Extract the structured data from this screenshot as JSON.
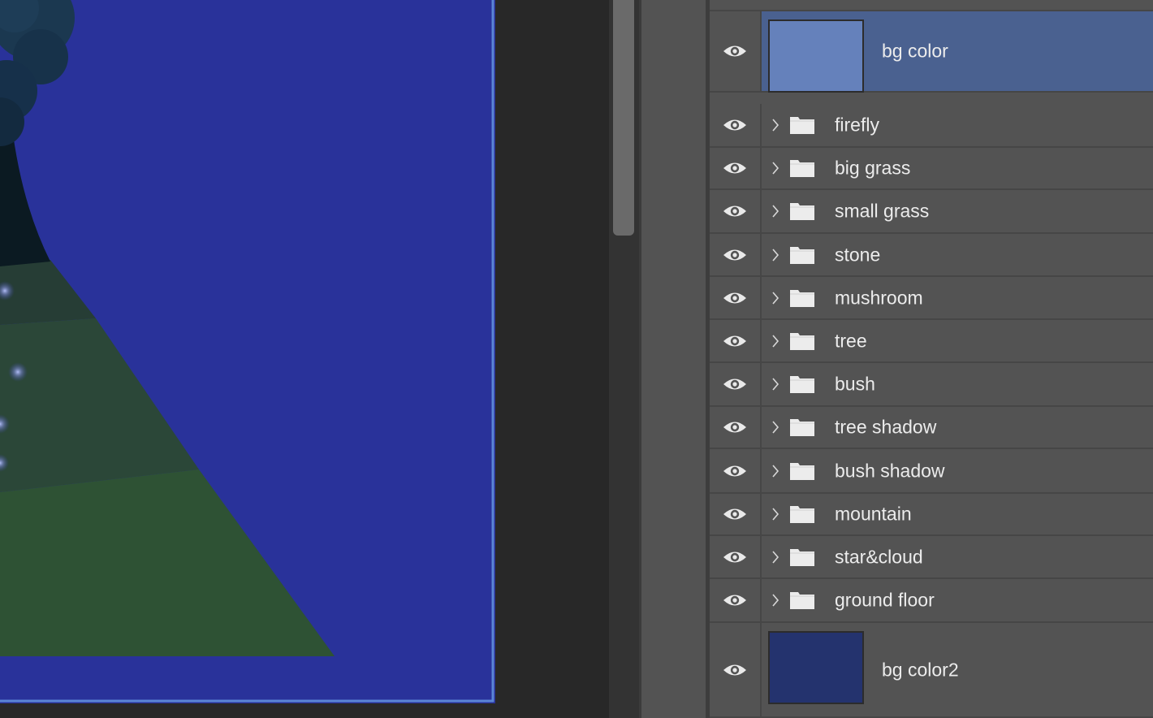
{
  "colors": {
    "canvas_bg": "#282828",
    "artboard_blue": "#29329a",
    "selection_border": "#5b86d6",
    "panel_bg": "#535353",
    "row_selected": "#4a6190",
    "thumb_bg_color": "#6581bb",
    "thumb_bg_color2": "#24336e",
    "grass_dark": "#263d35",
    "grass_mid": "#2b4738",
    "grass_light": "#2e5234",
    "tree_trunk": "#0b1a22",
    "tree_foliage": "#173045"
  },
  "layers": [
    {
      "name": "bg color",
      "type": "layer",
      "selected": true,
      "visible": true,
      "thumb": "thumb_bg_color"
    },
    {
      "name": "firefly",
      "type": "group",
      "visible": true
    },
    {
      "name": "big grass",
      "type": "group",
      "visible": true
    },
    {
      "name": "small grass",
      "type": "group",
      "visible": true
    },
    {
      "name": "stone",
      "type": "group",
      "visible": true
    },
    {
      "name": "mushroom",
      "type": "group",
      "visible": true
    },
    {
      "name": "tree",
      "type": "group",
      "visible": true
    },
    {
      "name": "bush",
      "type": "group",
      "visible": true
    },
    {
      "name": "tree shadow",
      "type": "group",
      "visible": true
    },
    {
      "name": "bush shadow",
      "type": "group",
      "visible": true
    },
    {
      "name": "mountain",
      "type": "group",
      "visible": true
    },
    {
      "name": "star&cloud",
      "type": "group",
      "visible": true
    },
    {
      "name": "ground floor",
      "type": "group",
      "visible": true
    },
    {
      "name": "bg color2",
      "type": "layer",
      "selected": false,
      "visible": true,
      "thumb": "thumb_bg_color2"
    }
  ],
  "icons": {
    "visibility": "eye-icon",
    "expand": "chevron-right-icon",
    "group": "folder-icon"
  }
}
